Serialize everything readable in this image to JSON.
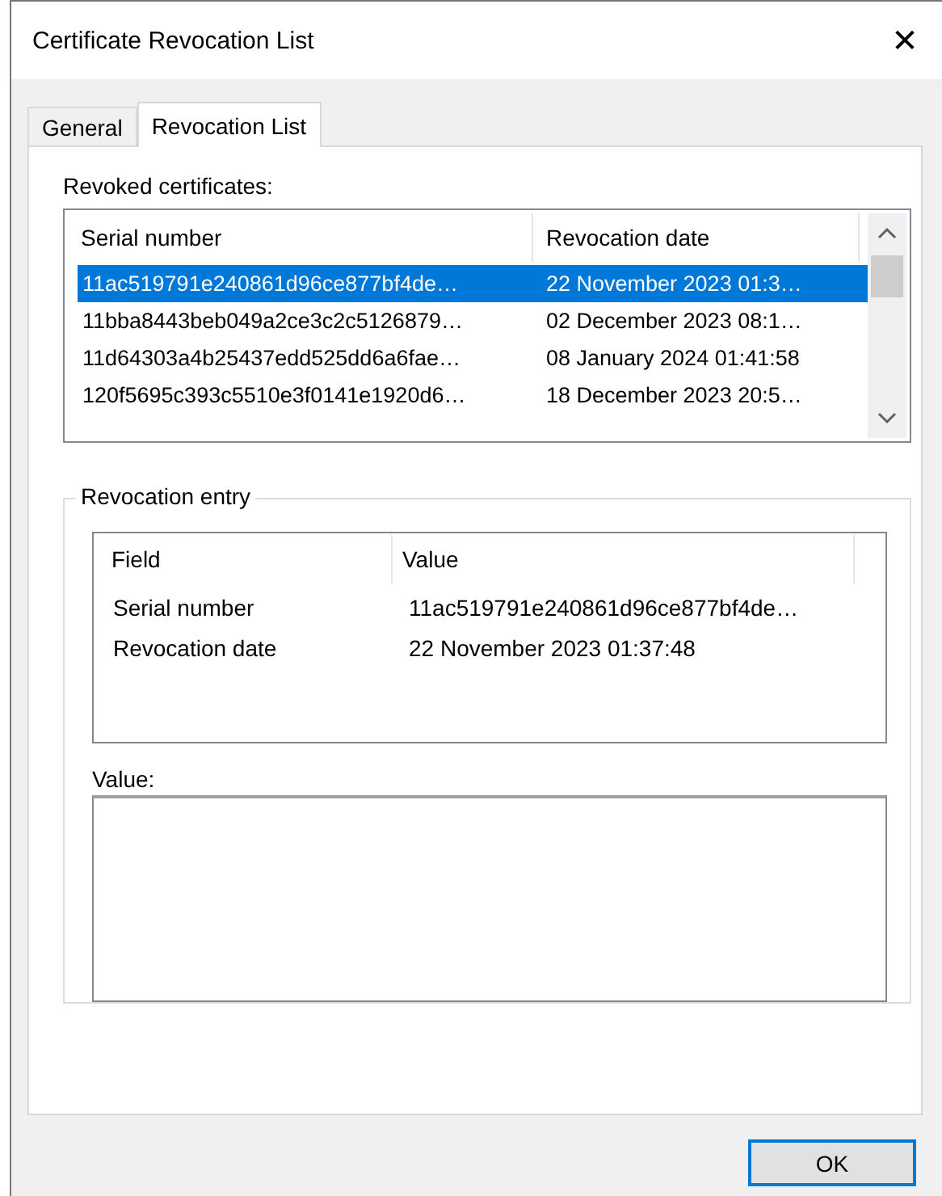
{
  "window": {
    "title": "Certificate Revocation List",
    "close": "✕"
  },
  "tabs": [
    {
      "label": "General",
      "selected": false
    },
    {
      "label": "Revocation List",
      "selected": true
    }
  ],
  "revoked": {
    "label": "Revoked certificates:",
    "columns": [
      "Serial number",
      "Revocation date"
    ],
    "rows": [
      {
        "serial": "11ac519791e240861d96ce877bf4de…",
        "date": "22 November 2023 01:3…",
        "selected": true
      },
      {
        "serial": "11bba8443beb049a2ce3c2c5126879…",
        "date": "02 December 2023 08:1…",
        "selected": false
      },
      {
        "serial": "11d64303a4b25437edd525dd6a6fae…",
        "date": "08 January 2024 01:41:58",
        "selected": false
      },
      {
        "serial": "120f5695c393c5510e3f0141e1920d6…",
        "date": "18 December 2023 20:5…",
        "selected": false
      }
    ]
  },
  "entry": {
    "title": "Revocation entry",
    "columns": [
      "Field",
      "Value"
    ],
    "rows": [
      {
        "field": "Serial number",
        "value": "11ac519791e240861d96ce877bf4de…"
      },
      {
        "field": "Revocation date",
        "value": "22 November 2023 01:37:48"
      }
    ],
    "value_label": "Value:"
  },
  "buttons": [
    {
      "label": "OK",
      "default": true
    }
  ]
}
